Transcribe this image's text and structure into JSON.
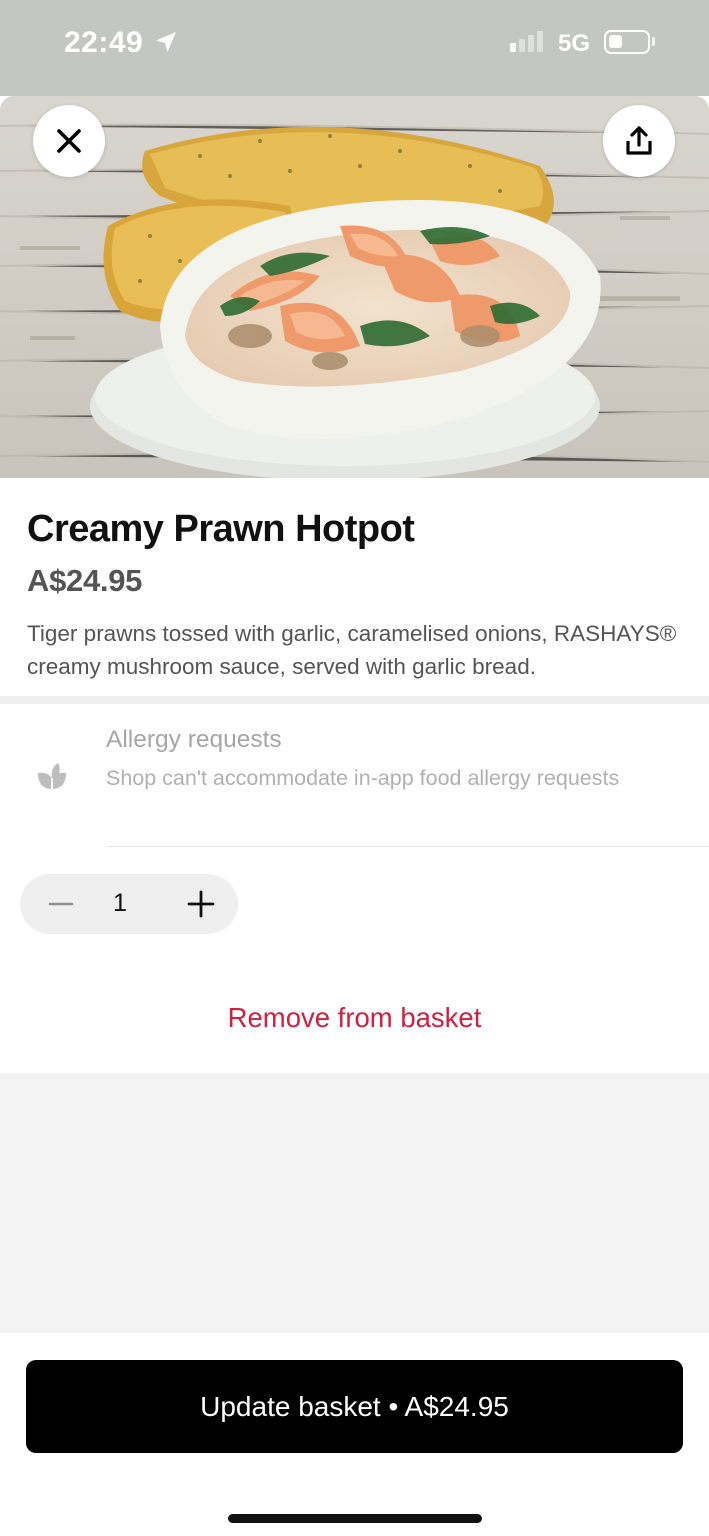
{
  "status_bar": {
    "time": "22:49",
    "network": "5G",
    "signal_bars_active": 1,
    "signal_bars_total": 4,
    "battery_level": 0.3
  },
  "hero": {
    "image_subject": "creamy prawn hotpot in white bowl with garlic bread",
    "close_icon": "close-icon",
    "share_icon": "share-icon"
  },
  "item": {
    "name": "Creamy Prawn Hotpot",
    "price": "A$24.95",
    "description": "Tiger prawns tossed with garlic, caramelised onions, RASHAYS® creamy mushroom sauce, served with garlic bread."
  },
  "allergy": {
    "icon": "allergy-leaf-icon",
    "title": "Allergy requests",
    "subtitle": "Shop can't accommodate in-app food allergy requests"
  },
  "quantity": {
    "value": "1",
    "minus_icon": "minus-icon",
    "plus_icon": "plus-icon"
  },
  "actions": {
    "remove_label": "Remove from basket",
    "update_label": "Update basket • A$24.95"
  },
  "colors": {
    "accent_remove": "#d11f3d",
    "primary_button": "#000000",
    "status_bar_bg": "#c3c6c2"
  }
}
